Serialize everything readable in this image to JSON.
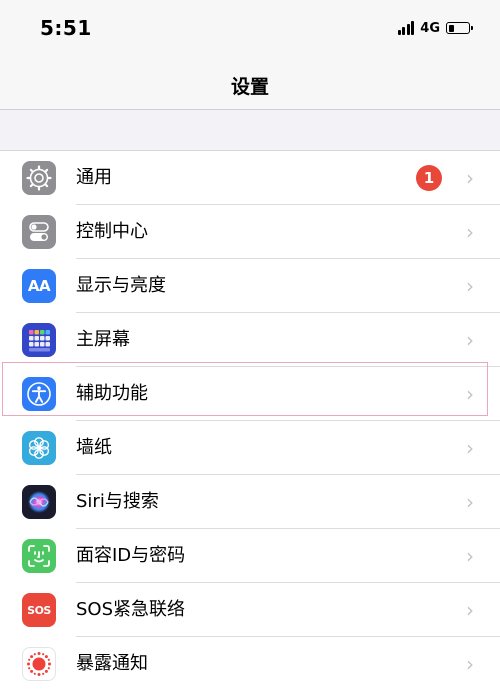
{
  "status_bar": {
    "time": "5:51",
    "network": "4G",
    "battery_level": 0.3
  },
  "nav": {
    "title": "设置"
  },
  "settings": {
    "items": [
      {
        "label": "通用",
        "icon": "gear-icon",
        "color": "#8e8e93",
        "badge": "1"
      },
      {
        "label": "控制中心",
        "icon": "toggles-icon",
        "color": "#8e8e93"
      },
      {
        "label": "显示与亮度",
        "icon": "aa-icon",
        "icon_text": "AA",
        "color": "#2f7cf6"
      },
      {
        "label": "主屏幕",
        "icon": "app-grid-icon",
        "color": "#3446c8"
      },
      {
        "label": "辅助功能",
        "icon": "accessibility-icon",
        "color": "#2f7cf6"
      },
      {
        "label": "墙纸",
        "icon": "flower-icon",
        "color": "#35aadc"
      },
      {
        "label": "Siri与搜索",
        "icon": "siri-icon",
        "color": "#1b1b2e"
      },
      {
        "label": "面容ID与密码",
        "icon": "face-id-icon",
        "color": "#4cc764"
      },
      {
        "label": "SOS紧急联络",
        "icon": "sos-icon",
        "icon_text": "SOS",
        "color": "#e8473a"
      },
      {
        "label": "暴露通知",
        "icon": "exposure-icon",
        "color": "#ffffff"
      }
    ]
  },
  "colors": {
    "badge": "#e8473a",
    "highlight_border": "#e9a8bd",
    "background": "#f2f2f7"
  }
}
